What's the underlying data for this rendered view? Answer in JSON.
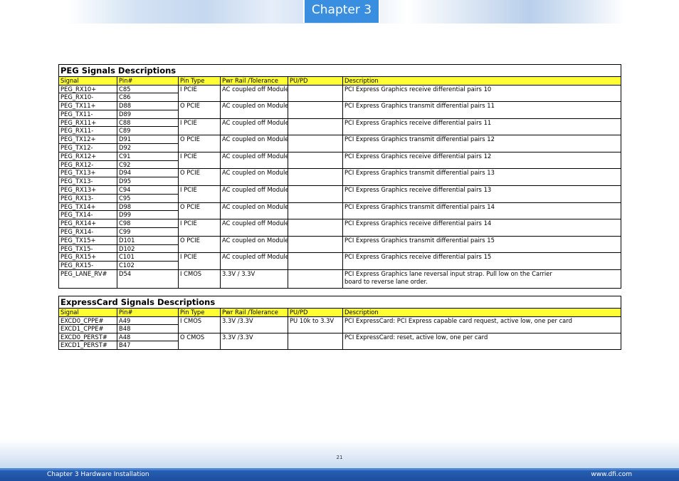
{
  "header": {
    "chapter_tab": "Chapter 3"
  },
  "peg": {
    "title": "PEG Signals Descriptions",
    "columns": [
      "Signal",
      "Pin#",
      "Pin Type",
      "Pwr Rail /Tolerance",
      "PU/PD",
      "Description"
    ],
    "groups": [
      {
        "signals": [
          "PEG_RX10+",
          "PEG_RX10-"
        ],
        "pins": [
          "C85",
          "C86"
        ],
        "pin_type": "I PCIE",
        "pwr": "AC coupled off Module",
        "pupd": "",
        "desc": "PCI Express Graphics receive differential pairs 10"
      },
      {
        "signals": [
          "PEG_TX11+",
          "PEG_TX11-"
        ],
        "pins": [
          "D88",
          "D89"
        ],
        "pin_type": "O PCIE",
        "pwr": "AC coupled on Module",
        "pupd": "",
        "desc": "PCI Express Graphics transmit differential pairs 11"
      },
      {
        "signals": [
          "PEG_RX11+",
          "PEG_RX11-"
        ],
        "pins": [
          "C88",
          "C89"
        ],
        "pin_type": "I PCIE",
        "pwr": "AC coupled off Module",
        "pupd": "",
        "desc": "PCI Express Graphics receive differential pairs 11"
      },
      {
        "signals": [
          "PEG_TX12+",
          "PEG_TX12-"
        ],
        "pins": [
          "D91",
          "D92"
        ],
        "pin_type": "O PCIE",
        "pwr": "AC coupled on Module",
        "pupd": "",
        "desc": "PCI Express Graphics transmit differential pairs 12"
      },
      {
        "signals": [
          "PEG_RX12+",
          "PEG_RX12-"
        ],
        "pins": [
          "C91",
          "C92"
        ],
        "pin_type": "I PCIE",
        "pwr": "AC coupled off Module",
        "pupd": "",
        "desc": "PCI Express Graphics receive differential pairs 12"
      },
      {
        "signals": [
          "PEG_TX13+",
          "PEG_TX13-"
        ],
        "pins": [
          "D94",
          "D95"
        ],
        "pin_type": "O PCIE",
        "pwr": "AC coupled on Module",
        "pupd": "",
        "desc": "PCI Express Graphics transmit differential pairs 13"
      },
      {
        "signals": [
          "PEG_RX13+",
          "PEG_RX13-"
        ],
        "pins": [
          "C94",
          "C95"
        ],
        "pin_type": "I PCIE",
        "pwr": "AC coupled off Module",
        "pupd": "",
        "desc": "PCI Express Graphics receive differential pairs 13"
      },
      {
        "signals": [
          "PEG_TX14+",
          "PEG_TX14-"
        ],
        "pins": [
          "D98",
          "D99"
        ],
        "pin_type": "O PCIE",
        "pwr": "AC coupled on Module",
        "pupd": "",
        "desc": "PCI Express Graphics transmit differential pairs 14"
      },
      {
        "signals": [
          "PEG_RX14+",
          "PEG_RX14-"
        ],
        "pins": [
          "C98",
          "C99"
        ],
        "pin_type": "I PCIE",
        "pwr": "AC coupled off Module",
        "pupd": "",
        "desc": "PCI Express Graphics receive differential pairs 14"
      },
      {
        "signals": [
          "PEG_TX15+",
          "PEG_TX15-"
        ],
        "pins": [
          "D101",
          "D102"
        ],
        "pin_type": "O PCIE",
        "pwr": "AC coupled on Module",
        "pupd": "",
        "desc": "PCI Express Graphics transmit differential pairs 15"
      },
      {
        "signals": [
          "PEG_RX15+",
          "PEG_RX15-"
        ],
        "pins": [
          "C101",
          "C102"
        ],
        "pin_type": "I PCIE",
        "pwr": "AC coupled off Module",
        "pupd": "",
        "desc": "PCI Express Graphics receive differential pairs 15"
      }
    ],
    "lane_rev": {
      "signal": "PEG_LANE_RV#",
      "pin": "D54",
      "pin_type": "I CMOS",
      "pwr": "3.3V / 3.3V",
      "pupd": "",
      "desc_line1": "PCI Express Graphics lane reversal input strap. Pull low on the Carrier",
      "desc_line2": "board to reverse lane order."
    }
  },
  "expresscard": {
    "title": "ExpressCard Signals Descriptions",
    "columns": [
      "Signal",
      "Pin#",
      "Pin Type",
      "Pwr Rail /Tolerance",
      "PU/PD",
      "Description"
    ],
    "groups": [
      {
        "signals": [
          "EXCD0_CPPE#",
          "EXCD1_CPPE#"
        ],
        "pins": [
          "A49",
          "B48"
        ],
        "pin_type": "I CMOS",
        "pwr": "3.3V /3.3V",
        "pupd": "PU 10k to 3.3V",
        "desc": "PCI ExpressCard: PCI Express capable card request, active low, one per card"
      },
      {
        "signals": [
          "EXCD0_PERST#",
          "EXCD1_PERST#"
        ],
        "pins": [
          "A48",
          "B47"
        ],
        "pin_type": "O CMOS",
        "pwr": "3.3V /3.3V",
        "pupd": "",
        "desc": "PCI ExpressCard: reset, active low, one per card"
      }
    ]
  },
  "footer": {
    "page_number": "21",
    "left": "Chapter 3 Hardware Installation",
    "right": "www.dfi.com"
  }
}
